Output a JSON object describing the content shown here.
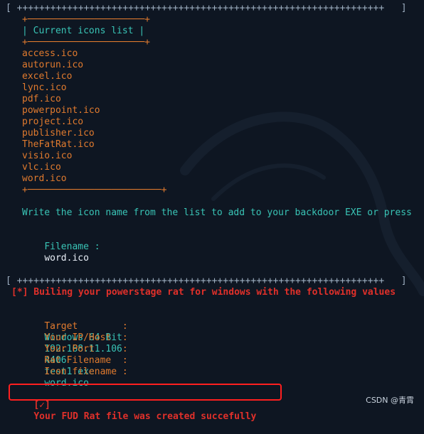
{
  "terminal": {
    "section1_border": "[ ++++++++++++++++++++++++++++++++++++++++++++++++++++++++++++++++++   ]",
    "box_top": "+─────────────────────+",
    "box_title": "| Current icons list |",
    "box_bottom": "+─────────────────────+",
    "icons": [
      "access.ico",
      "autorun.ico",
      "excel.ico",
      "lync.ico",
      "pdf.ico",
      "powerpoint.ico",
      "project.ico",
      "publisher.ico",
      "TheFatRat.ico",
      "visio.ico",
      "vlc.ico",
      "word.ico"
    ],
    "list_bottom": "+────────────────────────+",
    "prompt_text": "Write the icon name from the list to add to your backdoor EXE or press",
    "filename_label": "Filename :",
    "filename_value": "word.ico",
    "section2_border": "[ ++++++++++++++++++++++++++++++++++++++++++++++++++++++++++++++++++   ]",
    "building_message": "[*] Builing your powerstage rat for windows with the following values",
    "details": [
      {
        "label": "Target        :",
        "value": "Windows 64 Bit"
      },
      {
        "label": "Your IP/Host  :",
        "value": "192.168.11.106"
      },
      {
        "label": "Your Port     :",
        "value": "4406"
      },
      {
        "label": "Rat Filename  :",
        "value": "test1.exe"
      },
      {
        "label": "Icon filename :",
        "value": "word.ico"
      }
    ],
    "success_prefix": "[✓]",
    "success_message": "Your FUD Rat file was created succefully"
  },
  "watermark": "CSDN @青霄",
  "colors": {
    "background": "#0e1622",
    "orange": "#e07a2e",
    "teal": "#39c4b6",
    "red": "#e0302a",
    "highlight": "#ff1f1f"
  }
}
